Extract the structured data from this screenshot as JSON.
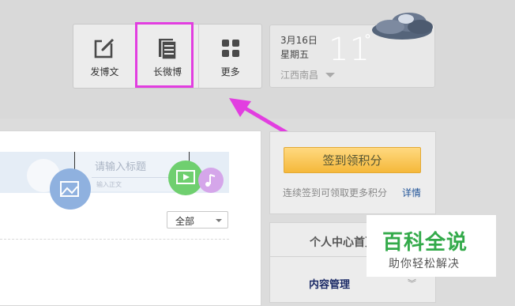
{
  "toolbar": {
    "items": [
      {
        "label": "发博文",
        "icon": "edit-icon"
      },
      {
        "label": "长微博",
        "icon": "long-post-icon"
      },
      {
        "label": "更多",
        "icon": "grid-icon"
      }
    ]
  },
  "weather": {
    "date": "3月16日",
    "weekday": "星期五",
    "temperature": "11",
    "degree": "°",
    "city": "江西南昌"
  },
  "editor": {
    "title_placeholder": "请输入标题",
    "body_placeholder": "输入正文"
  },
  "filter": {
    "selected": "全部"
  },
  "signin": {
    "button_label": "签到领积分",
    "note": "连续签到可领取更多积分",
    "detail_link": "详情"
  },
  "personal_center": {
    "title": "个人中心首页",
    "menu_item": "内容管理",
    "chevron": "»"
  },
  "watermark": {
    "title": "百科全说",
    "subtitle": "助你轻松解决"
  },
  "colors": {
    "highlight": "#e23ee0",
    "accent_green": "#33aa4a",
    "button_orange": "#f5b83a"
  }
}
